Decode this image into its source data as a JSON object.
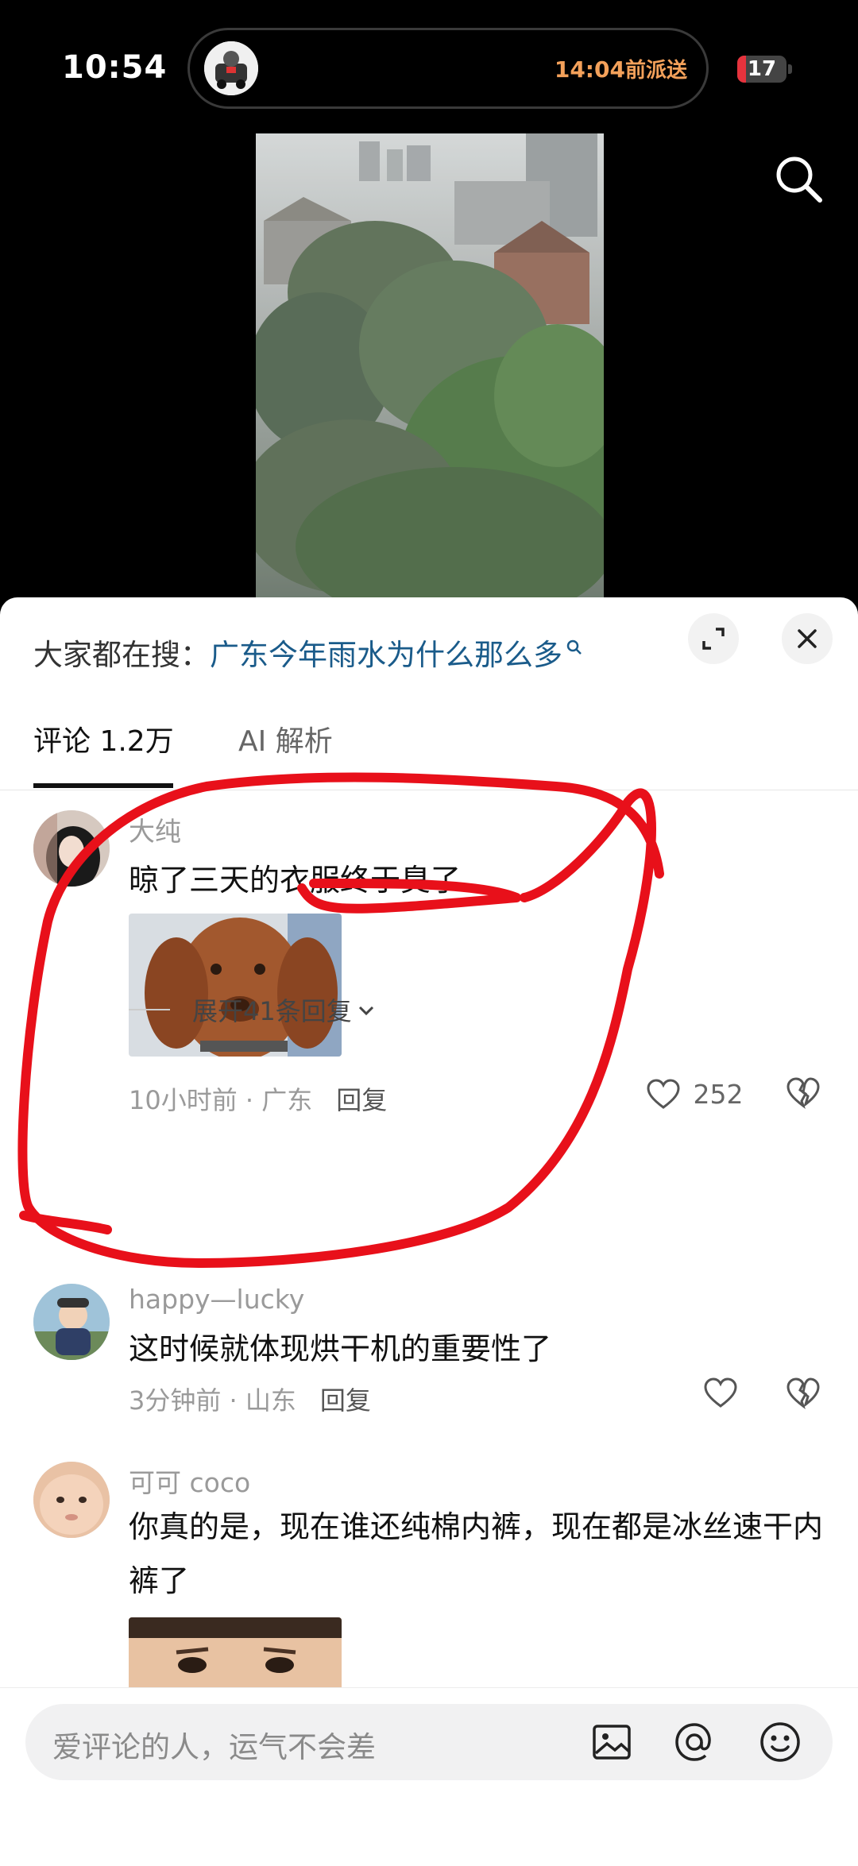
{
  "status_bar": {
    "time": "10:54",
    "delivery_time": "14:04",
    "delivery_text": "前派送",
    "battery": "17",
    "battery_color": "#e5333d"
  },
  "icons": [
    "search-icon",
    "expand-icon",
    "close-icon",
    "heart-icon",
    "broken-heart-icon",
    "chevron-down-icon",
    "image-icon",
    "at-icon",
    "emoji-icon"
  ],
  "hot_search": {
    "prefix": "大家都在搜：",
    "query": "广东今年雨水为什么那么多"
  },
  "tabs": [
    {
      "label": "评论 1.2万"
    },
    {
      "label": "AI 解析"
    }
  ],
  "comments": [
    {
      "user": "大纯",
      "text": "晾了三天的衣服终于臭了",
      "meta": "10小时前 · 广东",
      "reply": "回复",
      "likes": "252",
      "expand": "展开41条回复"
    },
    {
      "user": "happy—lucky",
      "text": "这时候就体现烘干机的重要性了",
      "meta": "3分钟前 · 山东",
      "reply": "回复",
      "likes": ""
    },
    {
      "user": "可可 coco",
      "text": "你真的是，现在谁还纯棉内裤，现在都是冰丝速干内裤了"
    }
  ],
  "input": {
    "placeholder": "爱评论的人，运气不会差"
  },
  "colors": {
    "link_blue": "#1a5b8a",
    "annotation_red": "#e8101a",
    "delivery_orange": "#f4a15a"
  }
}
